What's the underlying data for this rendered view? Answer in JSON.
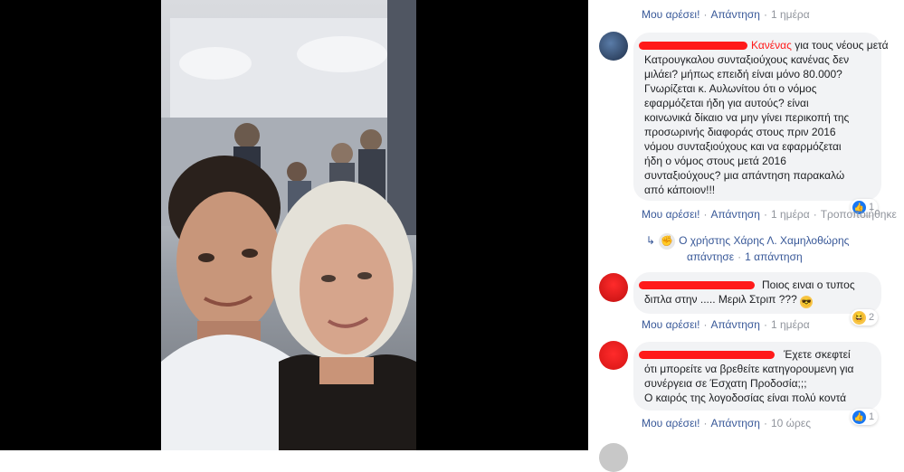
{
  "top_actions": {
    "like": "Μου αρέσει!",
    "reply": "Απάντηση",
    "time": "1 ημέρα"
  },
  "comments": [
    {
      "redacted_prefix": "Κανένας",
      "lines": [
        "για τους νέους μετά",
        "Κατρουγκαλου συνταξιούχους κανένας δεν",
        "μιλάει? μήπως επειδή είναι μόνο 80.000?",
        "Γνωρίζεται κ. Αυλωνίτου ότι ο νόμος",
        "εφαρμόζεται ήδη για αυτούς? είναι",
        "κοινωνικά δίκαιο να μην γίνει περικοπή της",
        "προσωρινής διαφοράς στους πριν 2016",
        "νόμου συνταξιούχους και να εφαρμόζεται",
        "ήδη ο νόμος στους μετά 2016",
        "συνταξιούχους? μια απάντηση παρακαλώ",
        "από κάποιον!!!"
      ],
      "reaction": {
        "icon": "like-icon",
        "count": "1"
      },
      "actions": {
        "like": "Μου αρέσει!",
        "reply": "Απάντηση",
        "time": "1 ημέρα",
        "extra": "Τροποποιήθηκε"
      },
      "reply_summary": {
        "author": "Ο χρήστης Χάρης Λ. Χαμηλοθώρης",
        "verb": "απάντησε",
        "time": "1 απάντηση"
      }
    },
    {
      "lines": [
        "Ποιος ειναι ο τυπος",
        "διπλα στην ..... Μεριλ Στριπ ???"
      ],
      "reaction": {
        "icon": "haha-icon",
        "count": "2"
      },
      "actions": {
        "like": "Μου αρέσει!",
        "reply": "Απάντηση",
        "time": "1 ημέρα"
      }
    },
    {
      "lines": [
        "Έχετε σκεφτεί",
        "ότι μπορείτε να βρεθείτε κατηγορουμενη για",
        "συνέργεια σε Έσχατη Προδοσία;;;",
        "Ο καιρός της λογοδοσίας είναι πολύ κοντά"
      ],
      "reaction": {
        "icon": "like-icon",
        "count": "1"
      },
      "actions": {
        "like": "Μου αρέσει!",
        "reply": "Απάντηση",
        "time": "10 ώρες"
      }
    }
  ],
  "colors": {
    "link": "#385898",
    "meta": "#90949c",
    "bubble": "#f2f3f5",
    "redaction": "#ff1a1a"
  }
}
